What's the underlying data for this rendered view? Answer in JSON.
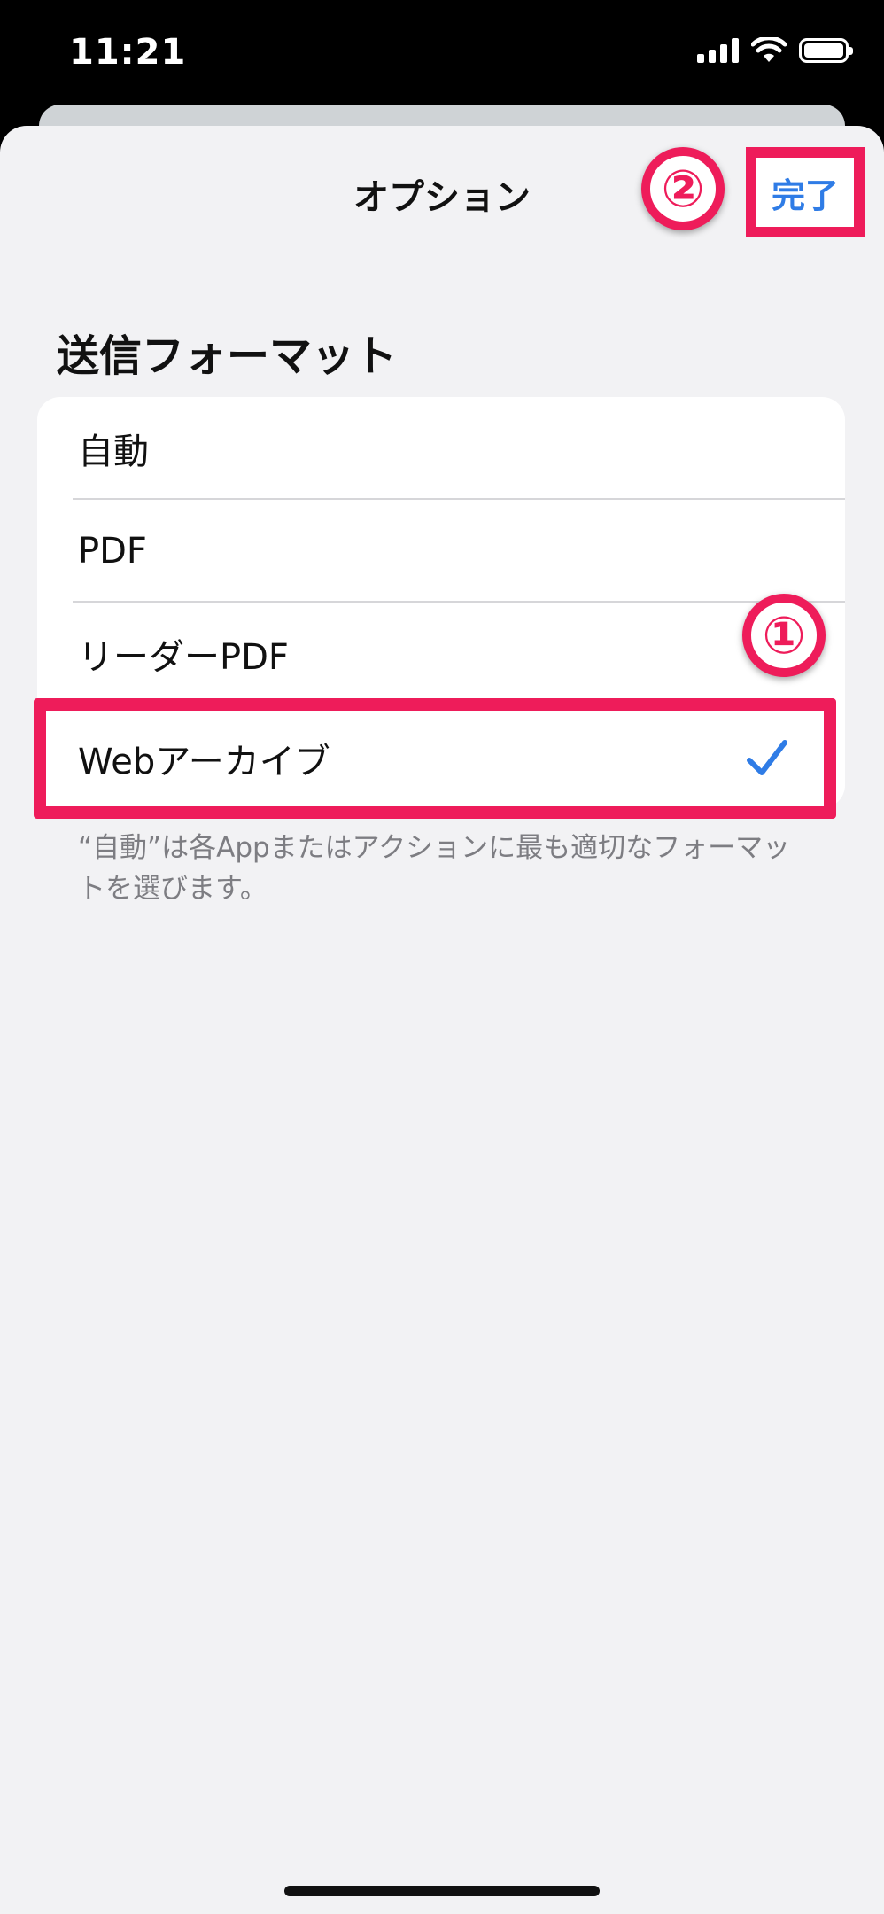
{
  "status_bar": {
    "time": "11:21"
  },
  "nav": {
    "title": "オプション",
    "done_label": "完了"
  },
  "annotations": {
    "badge_1": "①",
    "badge_2": "②",
    "highlight_color": "#ee1c5a"
  },
  "section": {
    "title": "送信フォーマット",
    "options": [
      {
        "label": "自動",
        "selected": false
      },
      {
        "label": "PDF",
        "selected": false
      },
      {
        "label": "リーダーPDF",
        "selected": false
      },
      {
        "label": "Webアーカイブ",
        "selected": true
      }
    ],
    "footer": "“自動”は各Appまたはアクションに最も適切なフォーマットを選びます。"
  },
  "colors": {
    "accent": "#2f7ce6",
    "sheet_background": "#f2f2f4"
  }
}
